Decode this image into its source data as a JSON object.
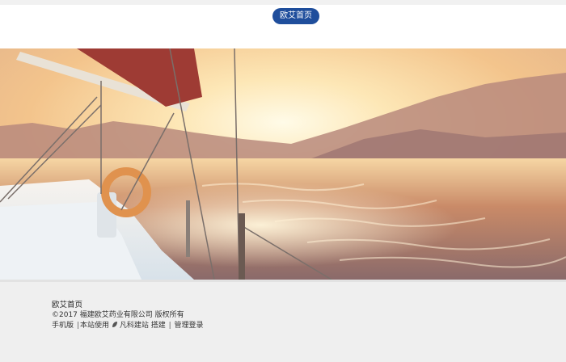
{
  "nav": {
    "home_label": "欧艾首页"
  },
  "hero": {
    "icon": "sailboat-sunset-photo"
  },
  "footer": {
    "title": "欧艾首页",
    "copyright": "©2017 福建欧艾药业有限公司 版权所有",
    "links": {
      "mobile": "手机版",
      "sep1": "|",
      "site_usage": "本站使用",
      "builder": "凡科建站",
      "build": "搭建",
      "sep2": "|",
      "admin_login": "管理登录"
    }
  }
}
